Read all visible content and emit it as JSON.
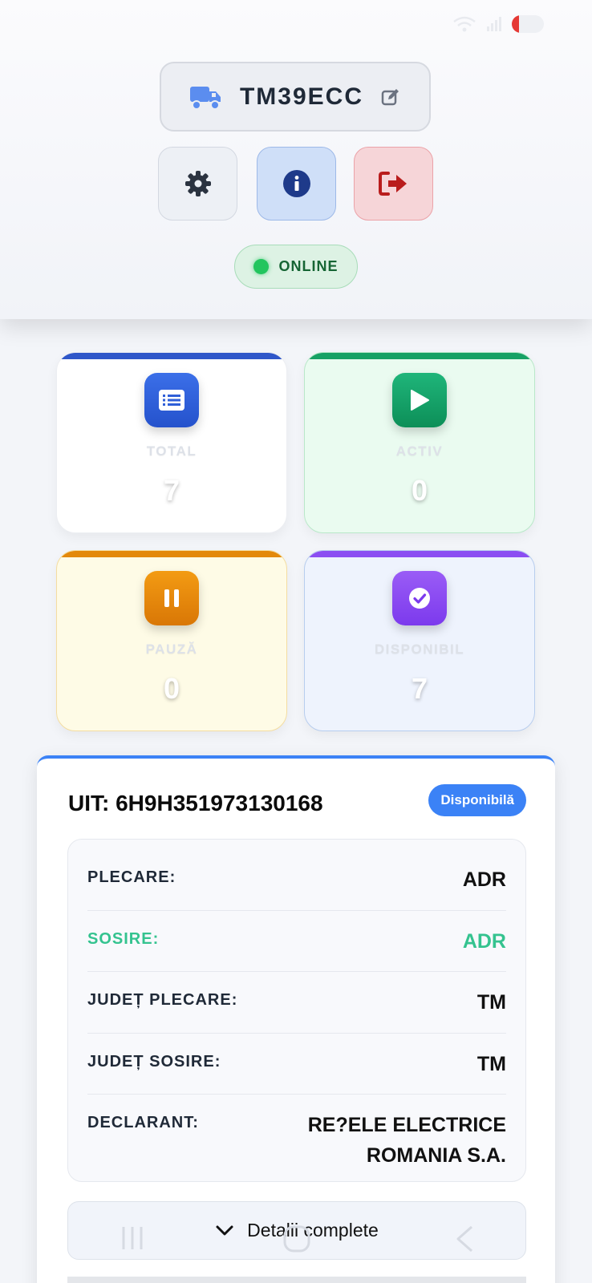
{
  "header": {
    "vehicle_plate": "TM39ECC",
    "status_label": "ONLINE"
  },
  "stats": [
    {
      "key": "total",
      "label": "TOTAL",
      "value": "7"
    },
    {
      "key": "activ",
      "label": "ACTIV",
      "value": "0"
    },
    {
      "key": "pauza",
      "label": "PAUZĂ",
      "value": "0"
    },
    {
      "key": "disponibil",
      "label": "DISPONIBIL",
      "value": "7"
    }
  ],
  "transport": {
    "uit_title": "UIT: 6H9H351973130168",
    "status_badge": "Disponibilă",
    "details": [
      {
        "label": "PLECARE:",
        "value": "ADR"
      },
      {
        "label": "SOSIRE:",
        "value": "ADR"
      },
      {
        "label": "JUDEȚ PLECARE:",
        "value": "TM"
      },
      {
        "label": "JUDEȚ SOSIRE:",
        "value": "TM"
      },
      {
        "label": "DECLARANT:",
        "value": "RE?ELE ELECTRICE ROMANIA S.A."
      }
    ],
    "details_toggle": "Detalii complete"
  },
  "colors": {
    "accent_blue": "#3b82f6",
    "online_green": "#22c55e",
    "sosire_green": "#34c38f",
    "logout_red": "#b91c1c"
  },
  "icons": {
    "vehicle": "truck-icon",
    "edit": "edit-icon",
    "settings": "gear-icon",
    "info": "info-icon",
    "logout": "logout-icon",
    "total": "list-icon",
    "activ": "play-icon",
    "pauza": "pause-icon",
    "disponibil": "check-circle-icon",
    "toggle": "chevron-down-icon"
  }
}
